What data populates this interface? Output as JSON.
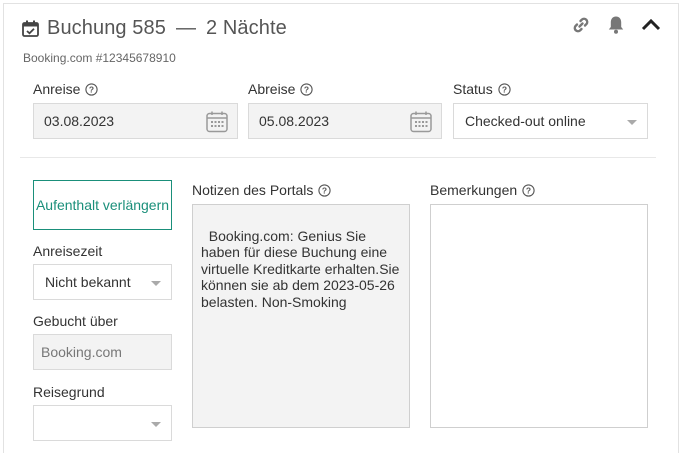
{
  "header": {
    "title": "Buchung 585",
    "dash": "—",
    "nights": "2 Nächte",
    "subtitle": "Booking.com #12345678910",
    "icons": [
      "calendar-check-icon",
      "link-icon",
      "bell-icon",
      "chevron-up-icon"
    ]
  },
  "fields": {
    "arrival": {
      "label": "Anreise",
      "value": "03.08.2023"
    },
    "departure": {
      "label": "Abreise",
      "value": "05.08.2023"
    },
    "status": {
      "label": "Status",
      "value": "Checked-out online"
    }
  },
  "sidebar": {
    "extend_button": "Aufenthalt verlängern",
    "arrival_time": {
      "label": "Anreisezeit",
      "value": "Nicht bekannt"
    },
    "booked_via": {
      "label": "Gebucht über",
      "value": "Booking.com"
    },
    "travel_reason": {
      "label": "Reisegrund",
      "value": ""
    }
  },
  "portal_notes": {
    "label": "Notizen des Portals",
    "text": "Booking.com: Genius Sie haben für diese Buchung eine virtuelle Kreditkarte erhalten.Sie können sie ab dem 2023-05-26 belasten. Non-Smoking"
  },
  "remarks": {
    "label": "Bemerkungen",
    "text": ""
  },
  "colors": {
    "accent": "#1a8f7a",
    "input_bg": "#f3f3f3",
    "border": "#dadada",
    "text": "#333333"
  }
}
